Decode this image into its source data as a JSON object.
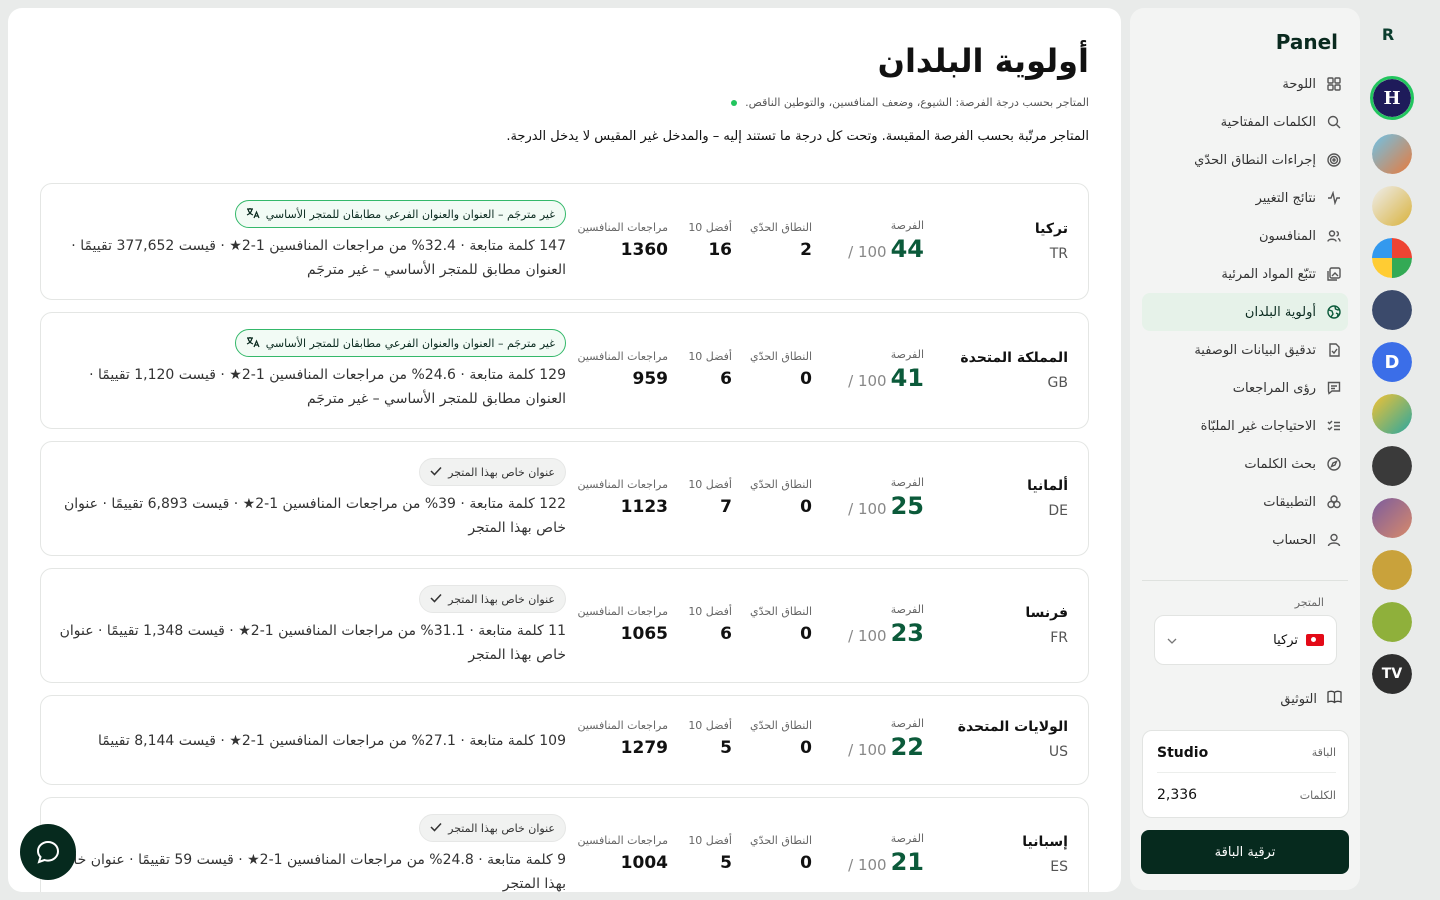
{
  "rail": {
    "logo": "R"
  },
  "sidebar": {
    "title": "Panel",
    "nav": [
      {
        "label": "اللوحة",
        "icon": "grid-icon"
      },
      {
        "label": "الكلمات المفتاحية",
        "icon": "search-icon"
      },
      {
        "label": "إجراءات النطاق الحدّي",
        "icon": "target-icon"
      },
      {
        "label": "نتائج التغيير",
        "icon": "activity-icon"
      },
      {
        "label": "المنافسون",
        "icon": "users-icon"
      },
      {
        "label": "تتبّع المواد المرئية",
        "icon": "images-icon"
      },
      {
        "label": "أولوية البلدان",
        "icon": "globe-icon",
        "active": true
      },
      {
        "label": "تدقيق البيانات الوصفية",
        "icon": "file-check-icon"
      },
      {
        "label": "رؤى المراجعات",
        "icon": "message-icon"
      },
      {
        "label": "الاحتياجات غير الملبّاة",
        "icon": "list-checks-icon"
      },
      {
        "label": "بحث الكلمات",
        "icon": "compass-icon"
      },
      {
        "label": "التطبيقات",
        "icon": "apps-icon"
      },
      {
        "label": "الحساب",
        "icon": "user-icon"
      }
    ],
    "store_label": "المتجر",
    "store_value": "تركيا",
    "docs_label": "التوثيق",
    "plan": {
      "label": "الباقة",
      "value": "Studio",
      "words_label": "الكلمات",
      "words_value": "2,336"
    },
    "upgrade_label": "ترقية الباقة"
  },
  "main": {
    "title": "أولوية البلدان",
    "legend": "المتاجر بحسب درجة الفرصة: الشيوع، وضعف المنافسين، والتوطين الناقص.",
    "description": "المتاجر مرتّبة بحسب الفرصة المقيسة. وتحت كل درجة ما تستند إليه – والمدخل غير المقيس لا يدخل الدرجة.",
    "labels": {
      "opportunity": "الفرصة",
      "edge": "النطاق الحدّي",
      "top10": "أفضل 10",
      "reviews": "مراجعات المنافسين",
      "max": "/ 100"
    },
    "countries": [
      {
        "name": "تركيا",
        "code": "TR",
        "score": "44",
        "edge": "2",
        "top10": "16",
        "reviews": "1360",
        "badge": "غير مترجَم – العنوان والعنوان الفرعي مطابقان للمتجر الأساسي",
        "badge_type": "green",
        "details": "147 كلمة متابعة · 32.4% من مراجعات المنافسين 1-2★ · قيست 377,652 تقييمًا · العنوان مطابق للمتجر الأساسي – غير مترجَم"
      },
      {
        "name": "المملكة المتحدة",
        "code": "GB",
        "score": "41",
        "edge": "0",
        "top10": "6",
        "reviews": "959",
        "badge": "غير مترجَم – العنوان والعنوان الفرعي مطابقان للمتجر الأساسي",
        "badge_type": "green",
        "details": "129 كلمة متابعة · 24.6% من مراجعات المنافسين 1-2★ · قيست 1,120 تقييمًا · العنوان مطابق للمتجر الأساسي – غير مترجَم"
      },
      {
        "name": "ألمانيا",
        "code": "DE",
        "score": "25",
        "edge": "0",
        "top10": "7",
        "reviews": "1123",
        "badge": "عنوان خاص بهذا المتجر",
        "badge_type": "gray",
        "details": "122 كلمة متابعة · 39% من مراجعات المنافسين 1-2★ · قيست 6,893 تقييمًا · عنوان خاص بهذا المتجر"
      },
      {
        "name": "فرنسا",
        "code": "FR",
        "score": "23",
        "edge": "0",
        "top10": "6",
        "reviews": "1065",
        "badge": "عنوان خاص بهذا المتجر",
        "badge_type": "gray",
        "details": "11 كلمة متابعة · 31.1% من مراجعات المنافسين 1-2★ · قيست 1,348 تقييمًا · عنوان خاص بهذا المتجر"
      },
      {
        "name": "الولايات المتحدة",
        "code": "US",
        "score": "22",
        "edge": "0",
        "top10": "5",
        "reviews": "1279",
        "badge": "",
        "badge_type": "none",
        "details": "109 كلمة متابعة · 27.1% من مراجعات المنافسين 1-2★ · قيست 8,144 تقييمًا"
      },
      {
        "name": "إسبانيا",
        "code": "ES",
        "score": "21",
        "edge": "0",
        "top10": "5",
        "reviews": "1004",
        "badge": "عنوان خاص بهذا المتجر",
        "badge_type": "gray",
        "details": "9 كلمة متابعة · 24.8% من مراجعات المنافسين 1-2★ · قيست 59 تقييمًا · عنوان خاص بهذا المتجر"
      }
    ]
  },
  "colors": {
    "accent": "#0b5a3a",
    "active_bg": "#e6f2e9",
    "badge_border": "#34b86a",
    "primary_button": "#062a1e"
  }
}
